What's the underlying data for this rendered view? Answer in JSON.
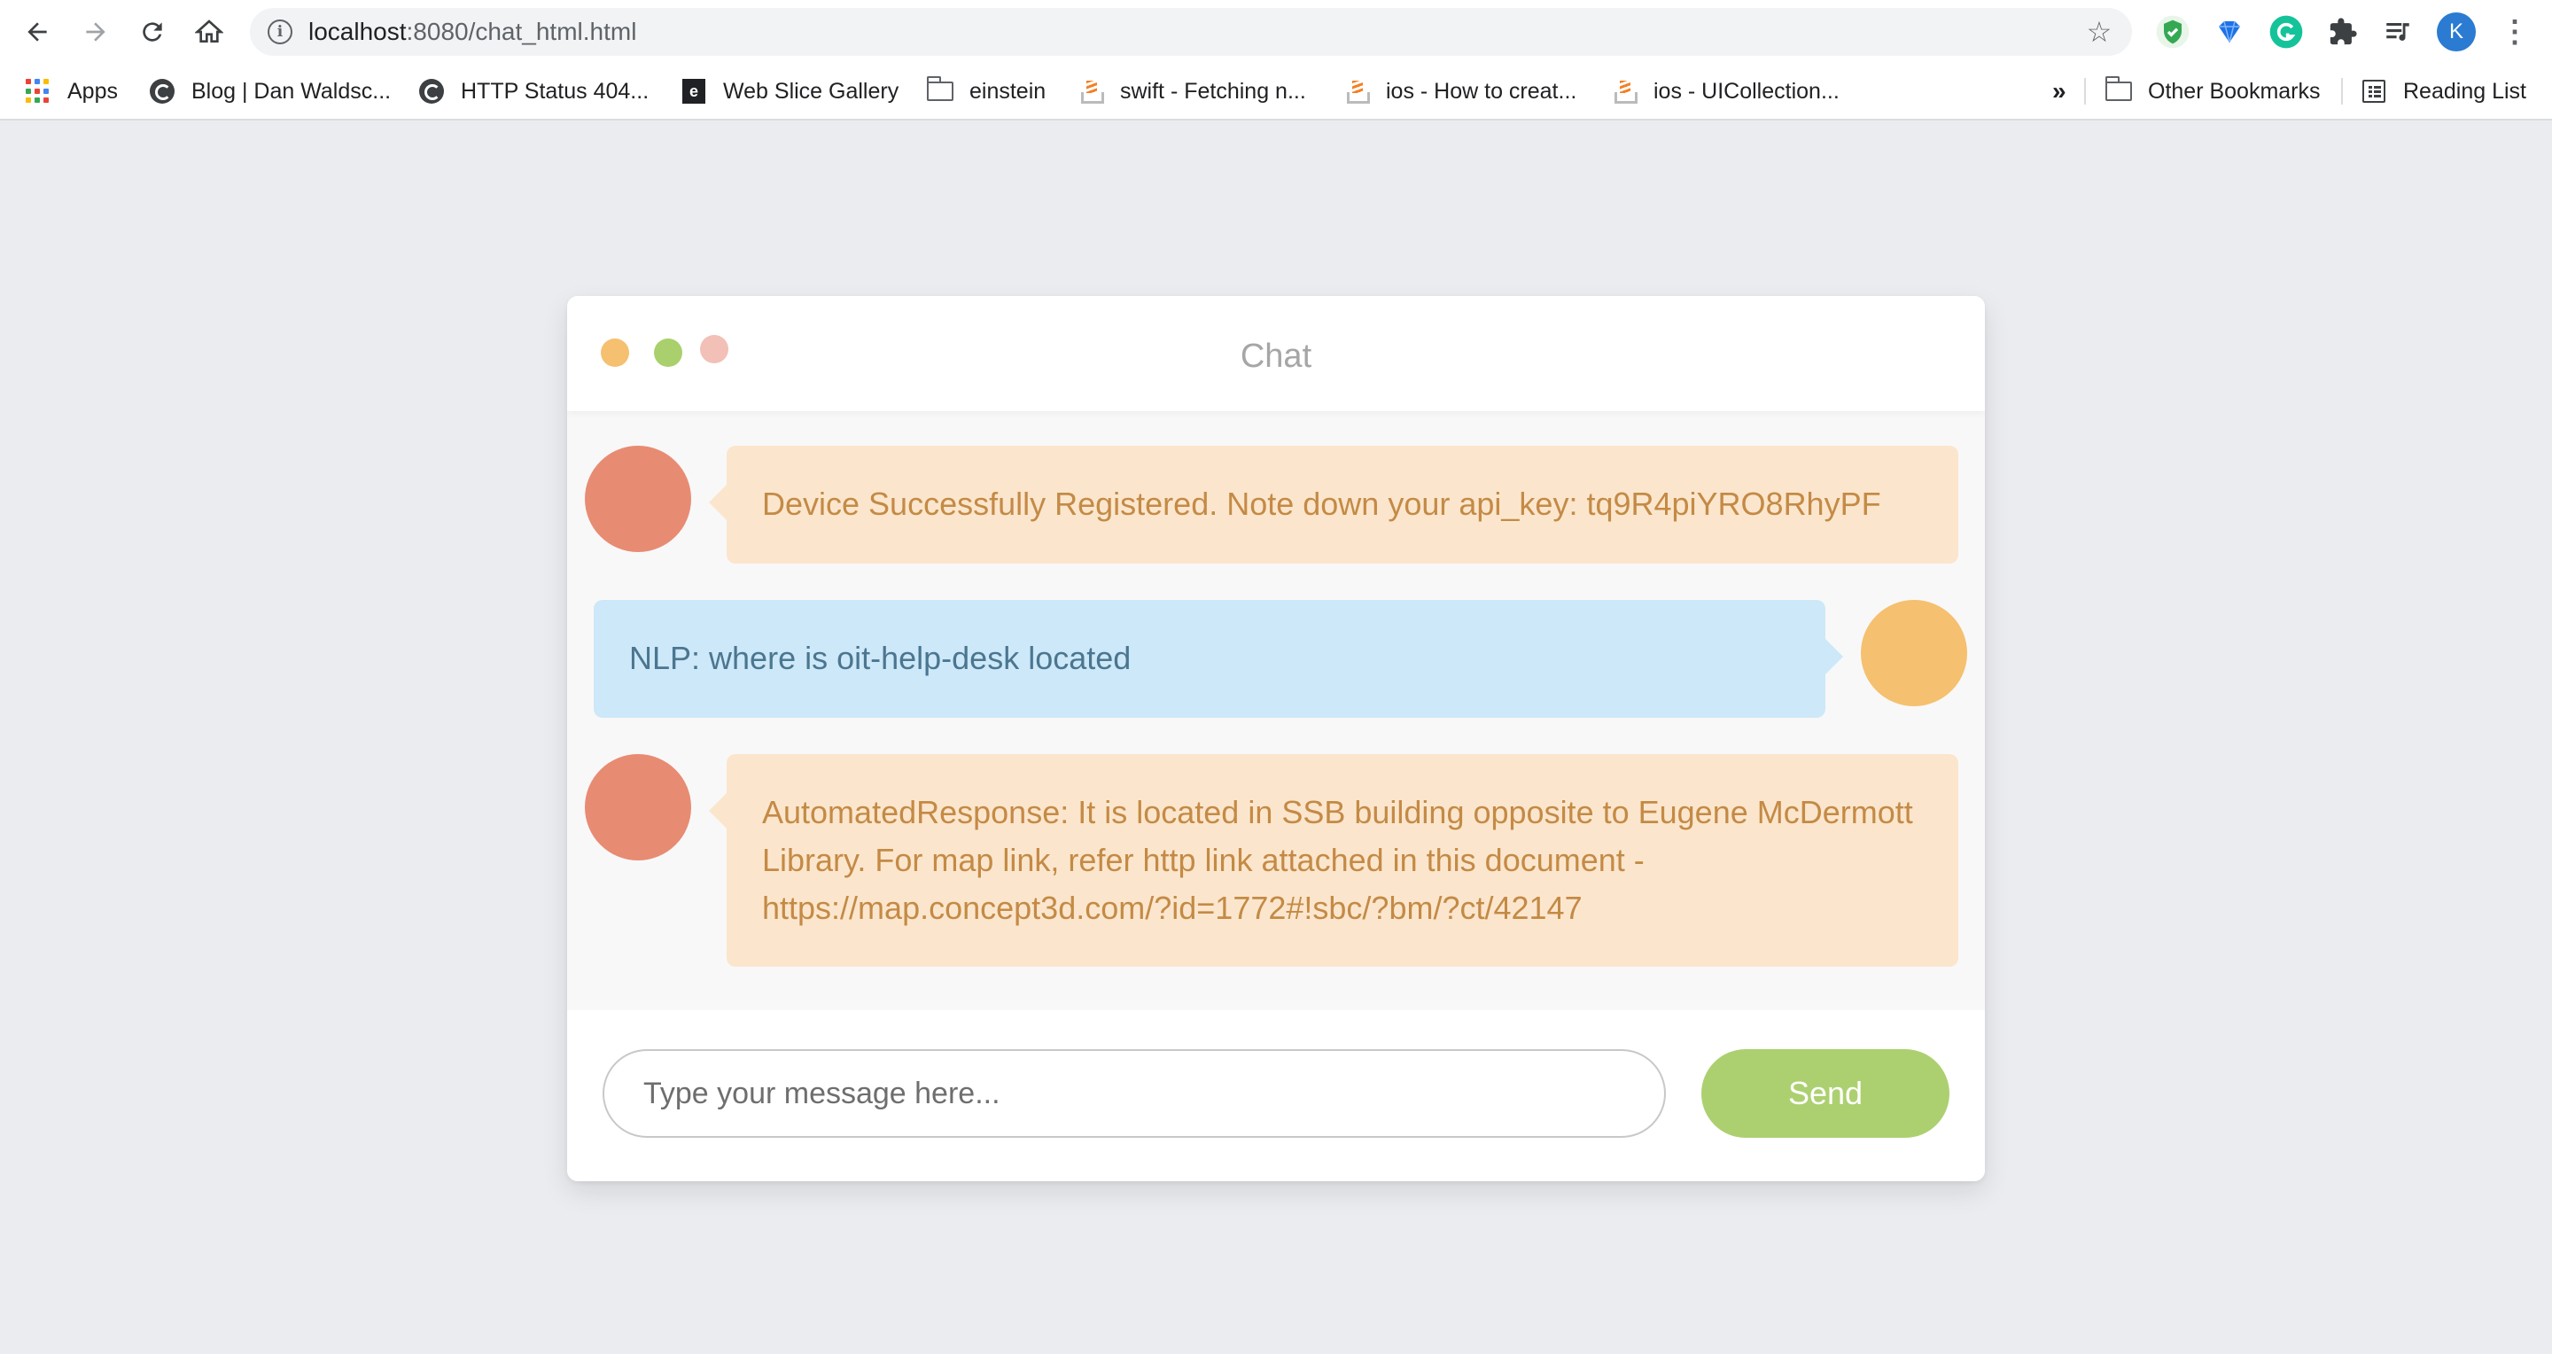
{
  "browser": {
    "url_host": "localhost",
    "url_path": ":8080/chat_html.html",
    "profile_initial": "K",
    "bookmarks": [
      {
        "label": "Apps",
        "icon": "apps-grid-icon"
      },
      {
        "label": "Blog | Dan Waldsc...",
        "icon": "globe-icon"
      },
      {
        "label": "HTTP Status 404...",
        "icon": "globe-icon"
      },
      {
        "label": "Web Slice Gallery",
        "icon": "web-slice-icon"
      },
      {
        "label": "einstein",
        "icon": "folder-icon"
      },
      {
        "label": "swift - Fetching n...",
        "icon": "stackoverflow-icon"
      },
      {
        "label": "ios - How to creat...",
        "icon": "stackoverflow-icon"
      },
      {
        "label": "ios - UICollection...",
        "icon": "stackoverflow-icon"
      }
    ],
    "overflow_label": "»",
    "other_bookmarks_label": "Other Bookmarks",
    "reading_list_label": "Reading List"
  },
  "chat": {
    "title": "Chat",
    "window_dots": [
      "#f5c06f",
      "#a9d06c",
      "#f2c0b6"
    ],
    "colors": {
      "bot_avatar": "#e88b73",
      "user_avatar": "#f5c06f",
      "bot_bubble": "#fbe6cd",
      "user_bubble": "#cde8f8",
      "send_button": "#acd070"
    },
    "messages": [
      {
        "side": "left",
        "text": "Device Successfully Registered. Note down your api_key: tq9R4piYRO8RhyPF"
      },
      {
        "side": "right",
        "text": "NLP: where is oit-help-desk located"
      },
      {
        "side": "left",
        "text": "AutomatedResponse: It is located in SSB building opposite to Eugene McDermott Library. For map link, refer http link attached in this document - https://map.concept3d.com/?id=1772#!sbc/?bm/?ct/42147"
      }
    ],
    "input_placeholder": "Type your message here...",
    "input_value": "",
    "send_label": "Send"
  }
}
